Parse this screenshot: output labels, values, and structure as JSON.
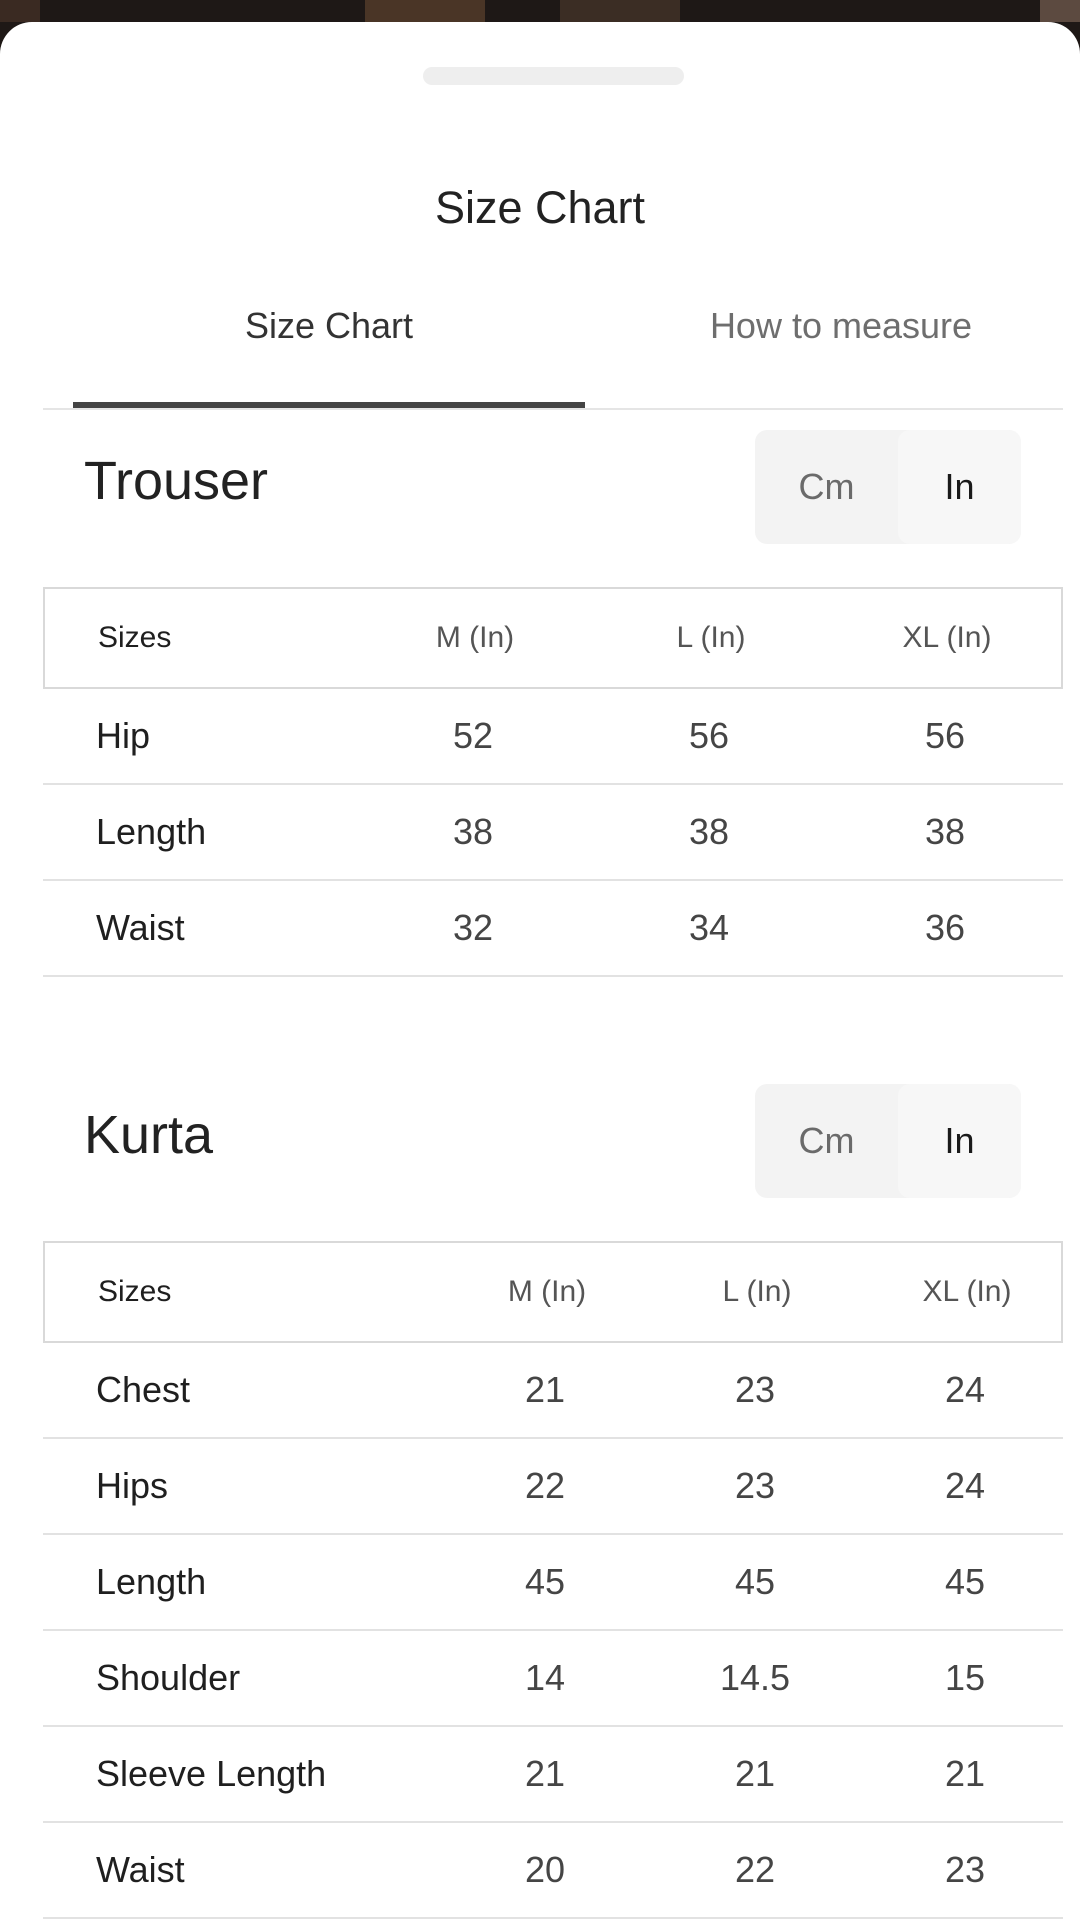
{
  "sheet": {
    "title": "Size Chart"
  },
  "tabs": [
    {
      "label": "Size Chart",
      "active": true
    },
    {
      "label": "How to measure",
      "active": false
    }
  ],
  "trouser": {
    "title": "Trouser",
    "units": {
      "cm_label": "Cm",
      "in_label": "In",
      "selected": "In"
    },
    "headers": [
      "Sizes",
      "M (In)",
      "L (In)",
      "XL (In)"
    ],
    "rows": [
      {
        "label": "Hip",
        "values": [
          "52",
          "56",
          "56"
        ]
      },
      {
        "label": "Length",
        "values": [
          "38",
          "38",
          "38"
        ]
      },
      {
        "label": "Waist",
        "values": [
          "32",
          "34",
          "36"
        ]
      }
    ]
  },
  "kurta": {
    "title": "Kurta",
    "units": {
      "cm_label": "Cm",
      "in_label": "In",
      "selected": "In"
    },
    "headers": [
      "Sizes",
      "M (In)",
      "L (In)",
      "XL (In)"
    ],
    "rows": [
      {
        "label": "Chest",
        "values": [
          "21",
          "23",
          "24"
        ]
      },
      {
        "label": "Hips",
        "values": [
          "22",
          "23",
          "24"
        ]
      },
      {
        "label": "Length",
        "values": [
          "45",
          "45",
          "45"
        ]
      },
      {
        "label": "Shoulder",
        "values": [
          "14",
          "14.5",
          "15"
        ]
      },
      {
        "label": "Sleeve Length",
        "values": [
          "21",
          "21",
          "21"
        ]
      },
      {
        "label": "Waist",
        "values": [
          "20",
          "22",
          "23"
        ]
      }
    ]
  }
}
